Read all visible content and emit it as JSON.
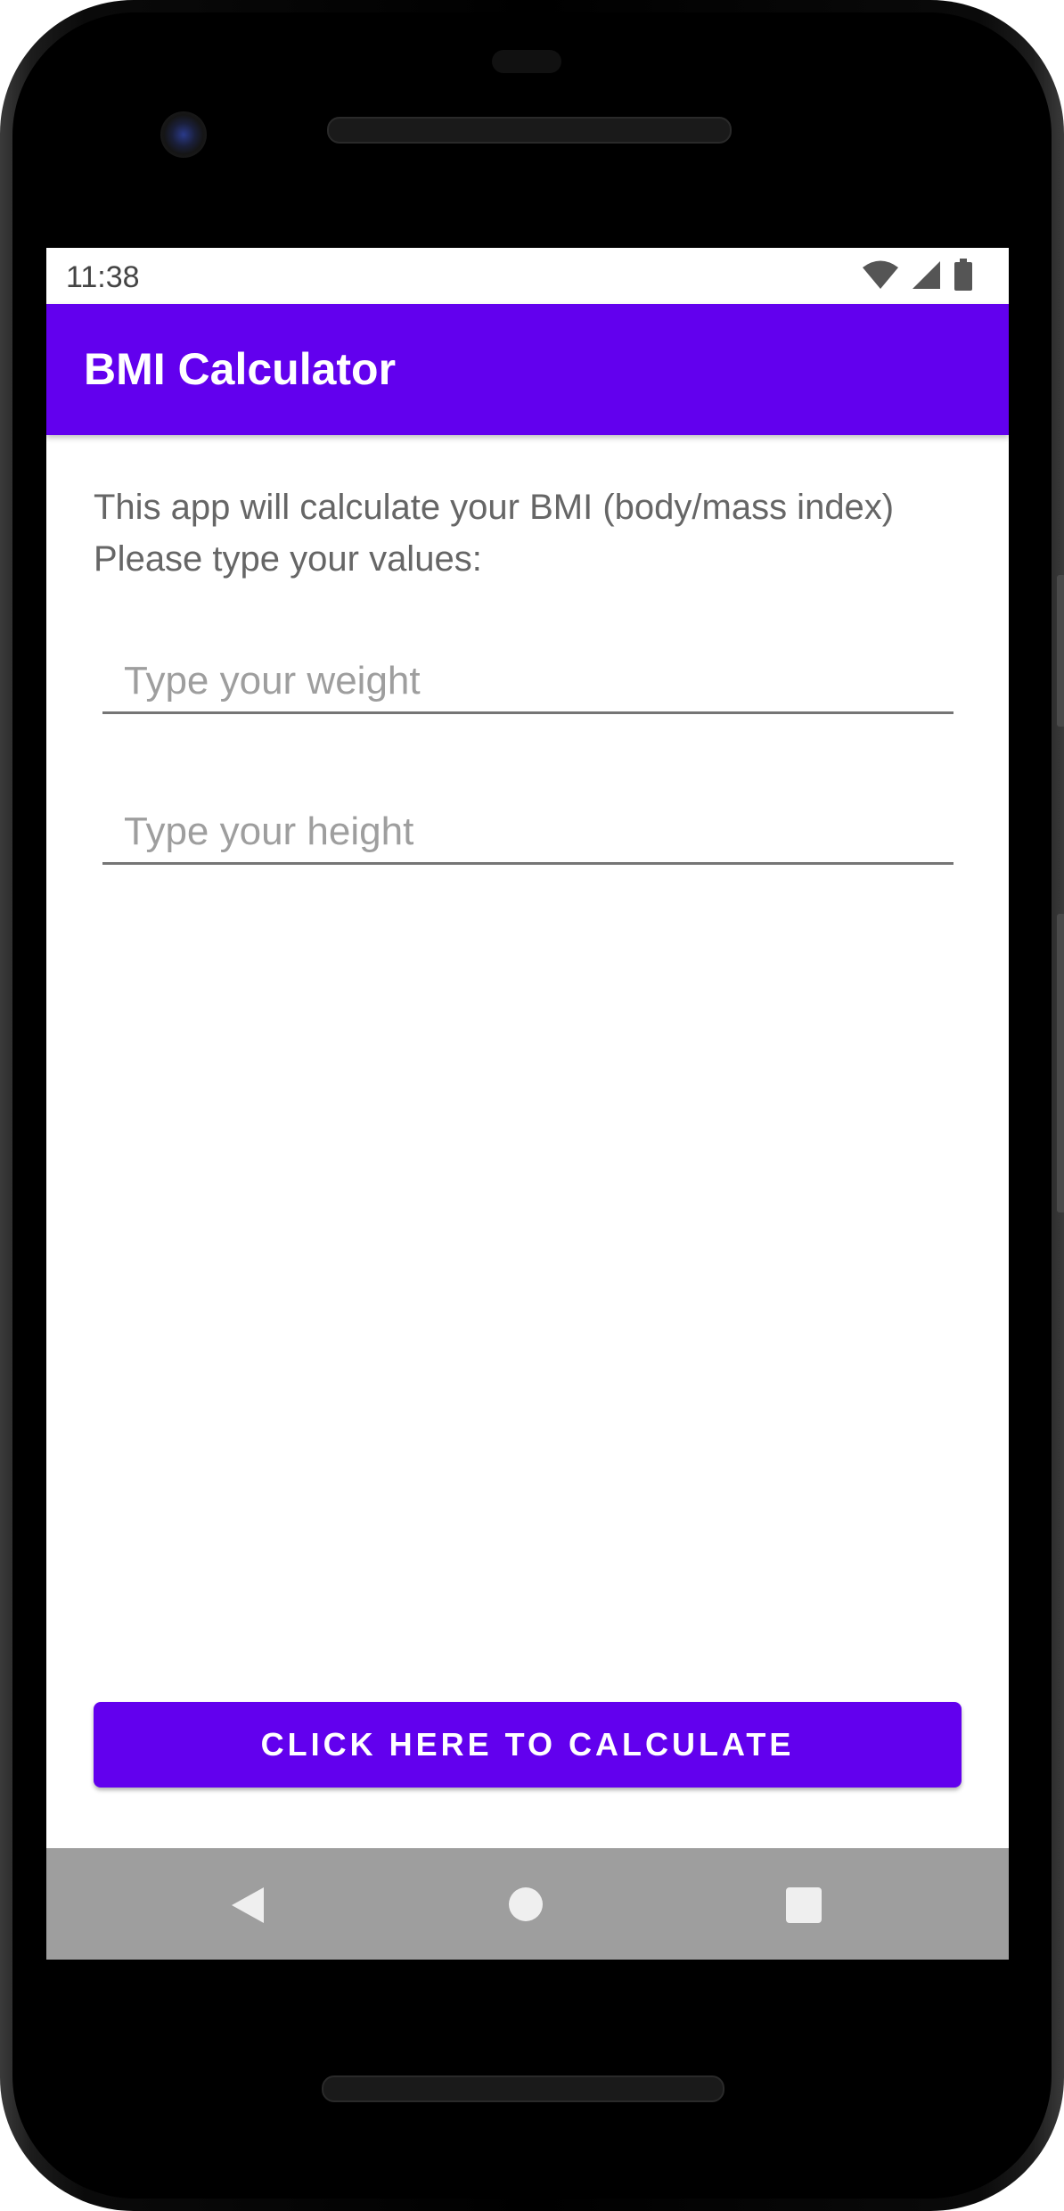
{
  "status_bar": {
    "time": "11:38",
    "icons": [
      "wifi-icon",
      "cellular-signal-icon",
      "battery-icon"
    ]
  },
  "app_bar": {
    "title": "BMI Calculator",
    "color": "#6200ee"
  },
  "intro": {
    "line1": "This app will calculate your BMI (body/mass index)",
    "line2": "Please type your values:"
  },
  "inputs": {
    "weight": {
      "value": "",
      "placeholder": "Type your weight"
    },
    "height": {
      "value": "",
      "placeholder": "Type your height"
    }
  },
  "calculate_button": {
    "label": "CLICK HERE TO CALCULATE",
    "color": "#6200ee"
  },
  "navigation": {
    "buttons": [
      "back-icon",
      "home-icon",
      "recent-apps-icon"
    ]
  }
}
